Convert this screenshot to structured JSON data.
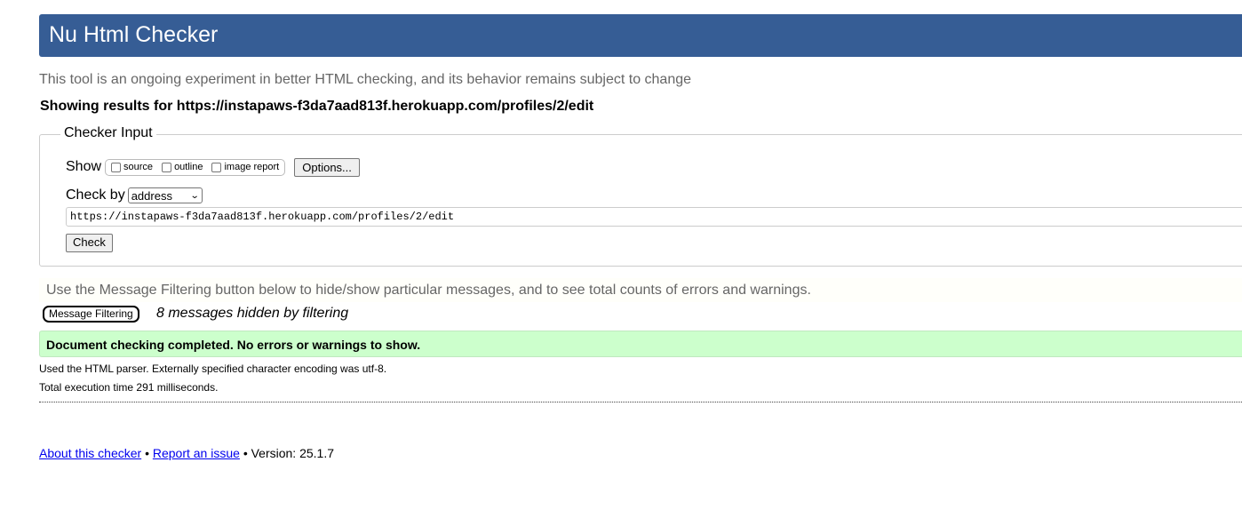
{
  "header": {
    "title": "Nu Html Checker"
  },
  "tagline": "This tool is an ongoing experiment in better HTML checking, and its behavior remains subject to change",
  "results_line": "Showing results for https://instapaws-f3da7aad813f.herokuapp.com/profiles/2/edit",
  "checker_input": {
    "legend": "Checker Input",
    "show_label": "Show",
    "checkboxes": [
      {
        "label": "source",
        "checked": false
      },
      {
        "label": "outline",
        "checked": false
      },
      {
        "label": "image report",
        "checked": false
      }
    ],
    "options_button": "Options...",
    "check_by_label": "Check by",
    "check_by_selected": "address",
    "url_value": "https://instapaws-f3da7aad813f.herokuapp.com/profiles/2/edit",
    "check_button": "Check"
  },
  "filtering": {
    "note": "Use the Message Filtering button below to hide/show particular messages, and to see total counts of errors and warnings.",
    "button": "Message Filtering",
    "hidden_count_text": "8 messages hidden by filtering"
  },
  "result": {
    "success_message": "Document checking completed. No errors or warnings to show.",
    "parser_info": "Used the HTML parser. Externally specified character encoding was utf-8.",
    "execution_time": "Total execution time 291 milliseconds."
  },
  "footer": {
    "about_link": "About this checker",
    "report_link": "Report an issue",
    "separator": "•",
    "version": "Version: 25.1.7"
  },
  "colors": {
    "header_bg": "#365d95",
    "success_bg": "#ccffcc",
    "link": "#0000ee"
  }
}
